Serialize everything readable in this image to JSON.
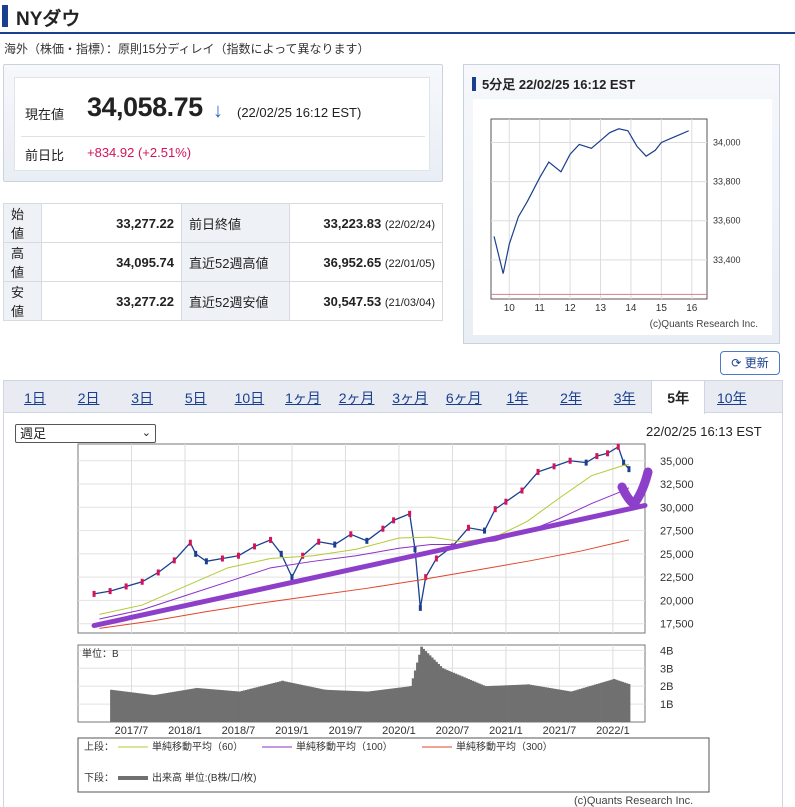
{
  "header": {
    "title": "NYダウ"
  },
  "note": "海外（株価・指標）：原則15分ディレイ（指数によって異なります）",
  "price": {
    "label_current": "現在値",
    "value": "34,058.75",
    "arrow": "↓",
    "timestamp": "(22/02/25 16:12 EST)",
    "label_change": "前日比",
    "change": "+834.92 (+2.51%)"
  },
  "stats": {
    "rows": [
      {
        "l1": "始値",
        "v1": "33,277.22",
        "l2": "前日終値",
        "v2": "33,223.83",
        "d2": "(22/02/24)"
      },
      {
        "l1": "高値",
        "v1": "34,095.74",
        "l2": "直近52週高値",
        "v2": "36,952.65",
        "d2": "(22/01/05)"
      },
      {
        "l1": "安値",
        "v1": "33,277.22",
        "l2": "直近52週安値",
        "v2": "30,547.53",
        "d2": "(21/03/04)"
      }
    ]
  },
  "mini": {
    "title": "5分足 22/02/25 16:12 EST",
    "copyright": "(c)Quants Research Inc."
  },
  "refresh_label": "更新",
  "tabs": [
    {
      "label": "1日"
    },
    {
      "label": "2日"
    },
    {
      "label": "3日"
    },
    {
      "label": "5日"
    },
    {
      "label": "10日"
    },
    {
      "label": "1ヶ月"
    },
    {
      "label": "2ヶ月"
    },
    {
      "label": "3ヶ月"
    },
    {
      "label": "6ヶ月"
    },
    {
      "label": "1年"
    },
    {
      "label": "2年"
    },
    {
      "label": "3年"
    },
    {
      "label": "5年",
      "active": true
    },
    {
      "label": "10年"
    }
  ],
  "period_select": {
    "value": "週足"
  },
  "chart_timestamp": "22/02/25 16:13 EST",
  "colors": {
    "up": "#d4145a",
    "down": "#1a3f8f",
    "ma60": "#b5c934",
    "ma100": "#8b2fc9",
    "ma300": "#e0462a",
    "annotation": "#8e3fc9",
    "volume": "#707070"
  },
  "legend": {
    "upper_label": "上段：",
    "lower_label": "下段：",
    "ma60": "単純移動平均（60）",
    "ma100": "単純移動平均（100）",
    "ma300": "単純移動平均（300）",
    "volume": "出来高 単位:(B株/口/枚)"
  },
  "chart_data": [
    {
      "type": "line",
      "title": "5分足 22/02/25 16:12 EST",
      "x": [
        9.5,
        9.8,
        10.0,
        10.3,
        10.6,
        11.0,
        11.3,
        11.7,
        12.0,
        12.3,
        12.7,
        13.0,
        13.3,
        13.6,
        13.9,
        14.2,
        14.5,
        14.8,
        15.0,
        15.3,
        15.6,
        15.9
      ],
      "values": [
        33520,
        33330,
        33480,
        33620,
        33700,
        33820,
        33900,
        33850,
        33940,
        33990,
        33970,
        34010,
        34050,
        34070,
        34060,
        33980,
        33930,
        33960,
        34000,
        34020,
        34040,
        34060
      ],
      "x_ticks": [
        "10",
        "11",
        "12",
        "13",
        "14",
        "15",
        "16"
      ],
      "y_ticks": [
        "33,400",
        "33,600",
        "33,800",
        "34,000"
      ],
      "xlim": [
        9.4,
        16.5
      ],
      "ylim": [
        33200,
        34120
      ],
      "baseline": 33223.83
    },
    {
      "type": "line",
      "title": "",
      "x_ticks": [
        "2017/7",
        "2018/1",
        "2018/7",
        "2019/1",
        "2019/7",
        "2020/1",
        "2020/7",
        "2021/1",
        "2021/7",
        "2022/1"
      ],
      "y_ticks": [
        "17,500",
        "20,000",
        "22,500",
        "25,000",
        "27,500",
        "30,000",
        "32,500",
        "35,000"
      ],
      "volume_ticks": [
        "1B",
        "2B",
        "3B",
        "4B"
      ],
      "volume_unit": "単位：B",
      "xlim": [
        2017.0,
        2022.3
      ],
      "ylim": [
        16500,
        36800
      ],
      "series": [
        {
          "name": "週足",
          "x": [
            2017.15,
            2017.3,
            2017.45,
            2017.6,
            2017.75,
            2017.9,
            2018.05,
            2018.1,
            2018.2,
            2018.35,
            2018.5,
            2018.65,
            2018.8,
            2018.9,
            2019.0,
            2019.1,
            2019.25,
            2019.4,
            2019.55,
            2019.7,
            2019.85,
            2019.95,
            2020.1,
            2020.15,
            2020.2,
            2020.25,
            2020.35,
            2020.5,
            2020.65,
            2020.8,
            2020.9,
            2021.0,
            2021.15,
            2021.3,
            2021.45,
            2021.6,
            2021.75,
            2021.85,
            2021.95,
            2022.05,
            2022.1,
            2022.15
          ],
          "values": [
            20700,
            21000,
            21500,
            22000,
            23000,
            24300,
            26200,
            25000,
            24200,
            24500,
            24800,
            25800,
            26500,
            25000,
            22500,
            24800,
            26300,
            26000,
            27100,
            26400,
            27700,
            28600,
            29300,
            25500,
            19200,
            22500,
            24500,
            25800,
            27800,
            27500,
            29800,
            30600,
            31800,
            33800,
            34400,
            35000,
            34800,
            35500,
            35800,
            36500,
            34800,
            34100
          ]
        },
        {
          "name": "単純移動平均（60）",
          "x": [
            2017.2,
            2017.6,
            2018.0,
            2018.4,
            2018.8,
            2019.2,
            2019.6,
            2020.0,
            2020.3,
            2020.6,
            2020.9,
            2021.2,
            2021.5,
            2021.8,
            2022.1,
            2022.15
          ],
          "values": [
            18500,
            19500,
            21500,
            23500,
            24500,
            24800,
            25500,
            26700,
            26800,
            26300,
            26800,
            28500,
            31000,
            33400,
            34500,
            34600
          ]
        },
        {
          "name": "単純移動平均（100）",
          "x": [
            2017.2,
            2017.6,
            2018.0,
            2018.4,
            2018.8,
            2019.2,
            2019.6,
            2020.0,
            2020.3,
            2020.6,
            2020.9,
            2021.2,
            2021.5,
            2021.8,
            2022.1,
            2022.15
          ],
          "values": [
            18000,
            19000,
            20500,
            22000,
            23500,
            24200,
            24800,
            25600,
            26000,
            26000,
            26400,
            27400,
            28800,
            30400,
            31800,
            32100
          ]
        },
        {
          "name": "単純移動平均（300）",
          "x": [
            2017.2,
            2017.7,
            2018.2,
            2018.7,
            2019.2,
            2019.7,
            2020.2,
            2020.7,
            2021.2,
            2021.7,
            2022.15
          ],
          "values": [
            17000,
            17800,
            18800,
            19700,
            20500,
            21300,
            22200,
            23200,
            24200,
            25300,
            26500
          ]
        }
      ],
      "volume": {
        "x": [
          2017.3,
          2017.7,
          2018.1,
          2018.5,
          2018.9,
          2019.3,
          2019.7,
          2020.1,
          2020.2,
          2020.4,
          2020.8,
          2021.2,
          2021.6,
          2022.0,
          2022.15
        ],
        "values": [
          1.8,
          1.5,
          1.9,
          1.7,
          2.3,
          1.8,
          1.7,
          2.0,
          4.2,
          3.0,
          2.0,
          2.1,
          1.7,
          2.4,
          2.1
        ]
      }
    }
  ]
}
